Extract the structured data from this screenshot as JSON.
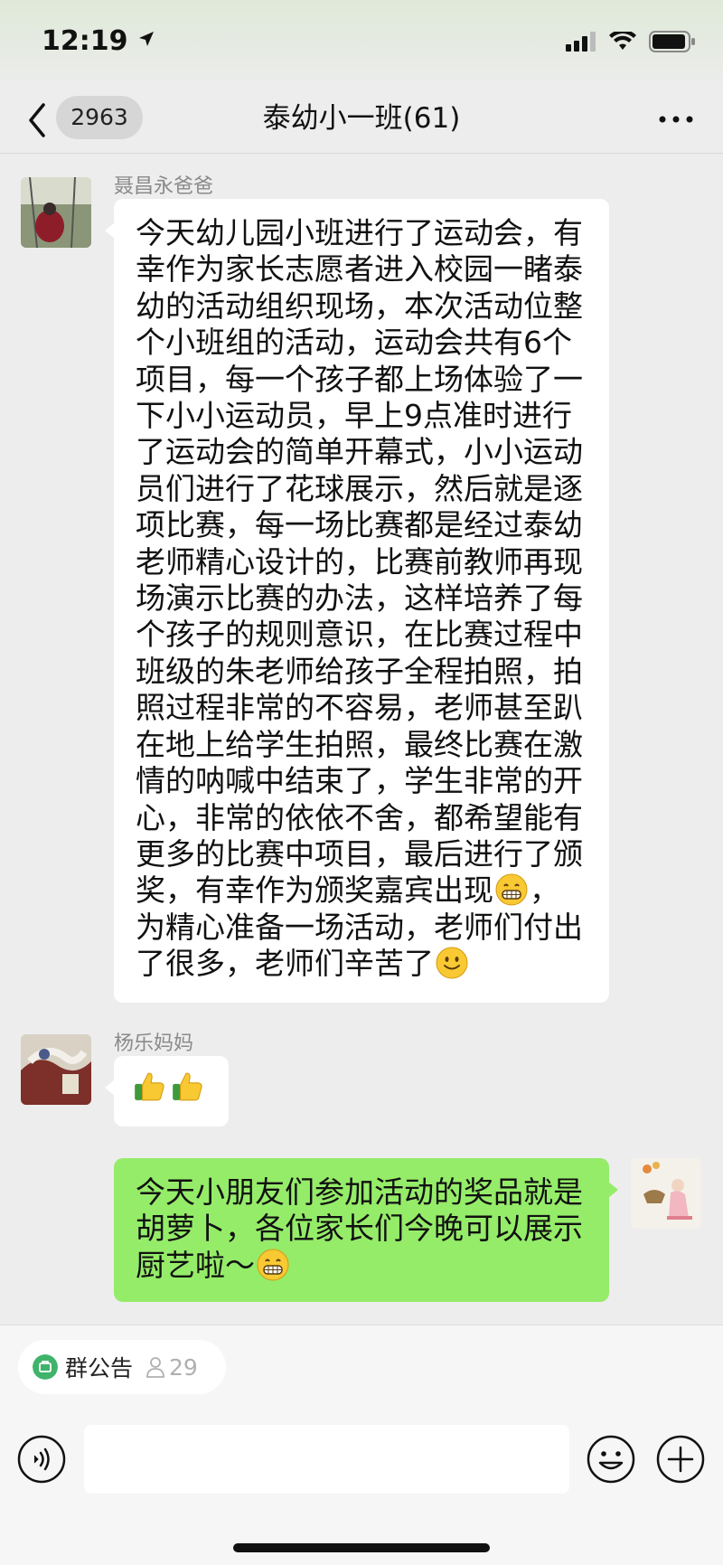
{
  "status_bar": {
    "time": "12:19"
  },
  "nav": {
    "back_count": "2963",
    "title": "泰幼小一班(61)"
  },
  "messages": [
    {
      "sender": "聂昌永爸爸",
      "lines": [
        "今天幼儿园小班进行了运动会，有",
        "幸作为家长志愿者进入校园一睹泰",
        "幼的活动组织现场，本次活动位整",
        "个小班组的活动，运动会共有6个",
        "项目，每一个孩子都上场体验了一",
        "下小小运动员，早上9点准时进行",
        "了运动会的简单开幕式，小小运动",
        "员们进行了花球展示，然后就是逐",
        "项比赛，每一场比赛都是经过泰幼",
        "老师精心设计的，比赛前教师再现",
        "场演示比赛的办法，这样培养了每",
        "个孩子的规则意识，在比赛过程中",
        "班级的朱老师给孩子全程拍照，拍",
        "照过程非常的不容易，老师甚至趴",
        "在地上给学生拍照，最终比赛在激",
        "情的呐喊中结束了，学生非常的开",
        "心，非常的依依不舍，都希望能有",
        "更多的比赛中项目，最后进行了颁",
        "奖，有幸作为颁奖嘉宾出现",
        "，",
        "为精心准备一场活动，老师们付出",
        "了很多，老师们辛苦了"
      ]
    },
    {
      "sender": "杨乐妈妈"
    },
    {
      "lines": [
        "今天小朋友们参加活动的奖品就是",
        "胡萝卜，各位家长们今晚可以展示",
        "厨艺啦～"
      ]
    }
  ],
  "bottom": {
    "notice_label": "群公告",
    "notice_count": "29",
    "input_value": ""
  },
  "colors": {
    "bubble_mine": "#95ec69",
    "bubble_other": "#ffffff",
    "chat_background": "#ededed",
    "notice_green": "#3fb36a"
  },
  "icons": [
    "back-icon",
    "more-icon",
    "signal-icon",
    "wifi-icon",
    "battery-icon",
    "location-arrow-icon",
    "grin-emoji",
    "smile-emoji",
    "thumbs-up-emoji",
    "voice-icon",
    "emoji-icon",
    "plus-icon",
    "notice-icon",
    "person-icon"
  ]
}
